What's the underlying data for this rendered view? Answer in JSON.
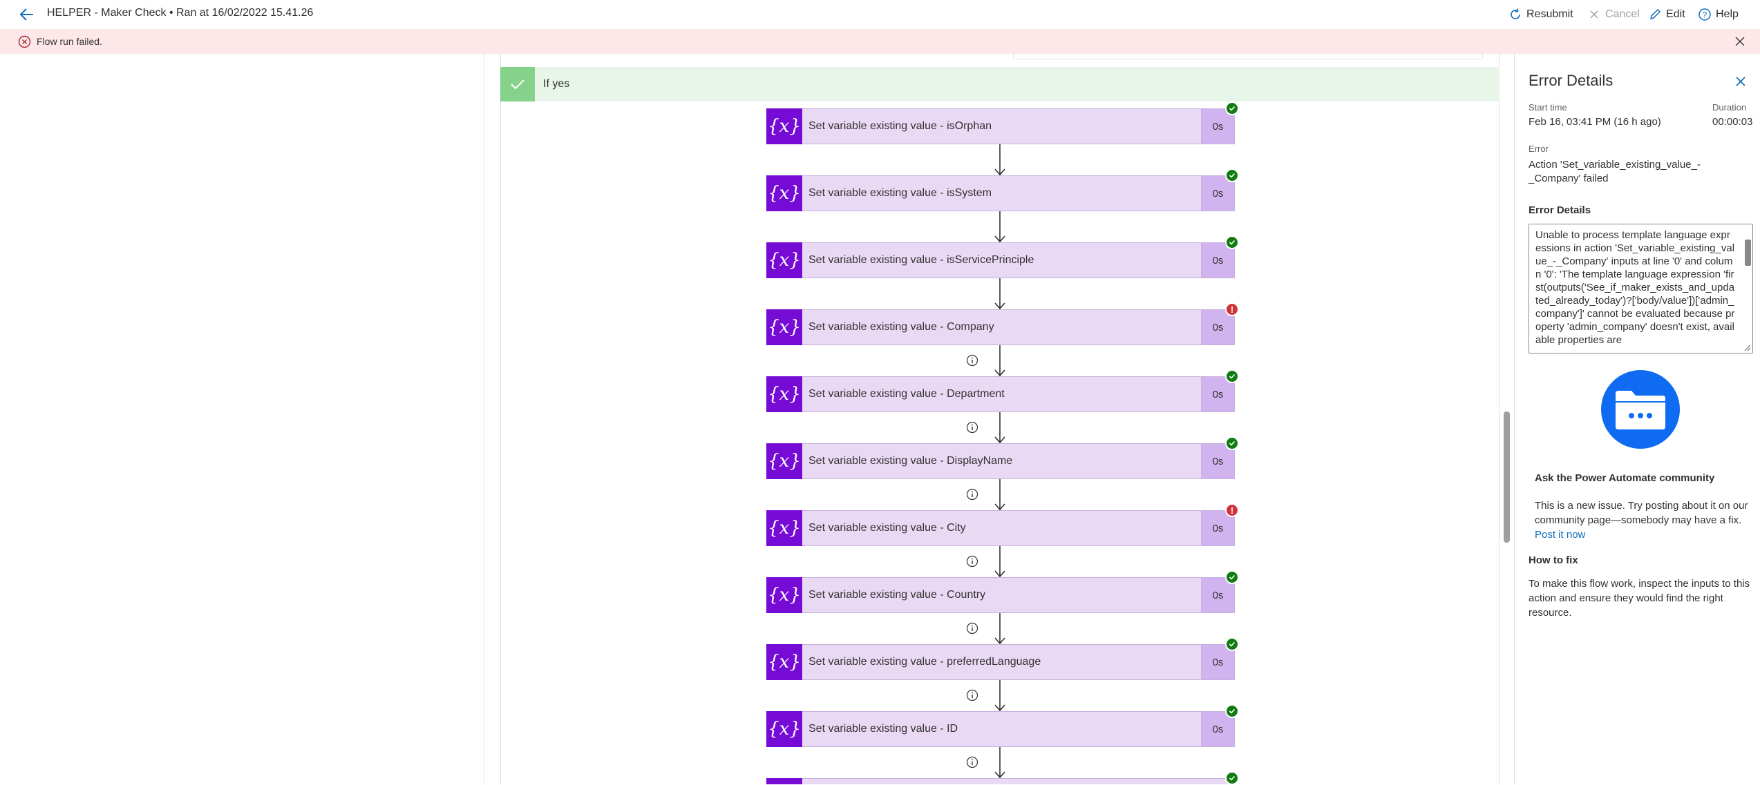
{
  "header": {
    "title": "HELPER - Maker Check • Ran at 16/02/2022 15.41.26",
    "resubmit_label": "Resubmit",
    "cancel_label": "Cancel",
    "edit_label": "Edit",
    "help_label": "Help"
  },
  "banner": {
    "message": "Flow run failed."
  },
  "scope": {
    "label": "If yes"
  },
  "actions": [
    {
      "label": "Set variable existing value - isOrphan",
      "duration": "0s",
      "status": "succeeded"
    },
    {
      "label": "Set variable existing value - isSystem",
      "duration": "0s",
      "status": "succeeded"
    },
    {
      "label": "Set variable existing value - isServicePrinciple",
      "duration": "0s",
      "status": "succeeded"
    },
    {
      "label": "Set variable existing value - Company",
      "duration": "0s",
      "status": "failed"
    },
    {
      "label": "Set variable existing value - Department",
      "duration": "0s",
      "status": "succeeded"
    },
    {
      "label": "Set variable existing value - DisplayName",
      "duration": "0s",
      "status": "succeeded"
    },
    {
      "label": "Set variable existing value - City",
      "duration": "0s",
      "status": "failed"
    },
    {
      "label": "Set variable existing value - Country",
      "duration": "0s",
      "status": "succeeded"
    },
    {
      "label": "Set variable existing value - preferredLanguage",
      "duration": "0s",
      "status": "succeeded"
    },
    {
      "label": "Set variable existing value - ID",
      "duration": "0s",
      "status": "succeeded"
    }
  ],
  "panel": {
    "title": "Error Details",
    "start_time_label": "Start time",
    "start_time_value": "Feb 16, 03:41 PM (16 h ago)",
    "duration_label": "Duration",
    "duration_value": "00:00:03",
    "error_label": "Error",
    "error_line1": "Action 'Set_variable_existing_value_-",
    "error_line2": "_Company' failed",
    "error_details_label": "Error Details",
    "error_details_text": "Unable to process template language expressions in action 'Set_variable_existing_value_-_Company' inputs at line '0' and column '0': 'The template language expression 'first(outputs('See_if_maker_exists_and_updated_already_today')?['body/value'])['admin_company']' cannot be evaluated because property 'admin_company' doesn't exist, available properties are",
    "community_heading": "Ask the Power Automate community",
    "community_text": "This is a new issue. Try posting about it on our community page—somebody may have a fix.",
    "post_link": "Post it now",
    "howto_heading": "How to fix",
    "howto_text": "To make this flow work, inspect the inputs to this action and ensure they would find the right resource."
  },
  "colors": {
    "variable_action": "#770bd6",
    "action_body": "#ead9f5",
    "success": "#107c10",
    "failure": "#d13438",
    "error_banner": "#fde7e9",
    "scope_header": "#e7f6e9"
  }
}
